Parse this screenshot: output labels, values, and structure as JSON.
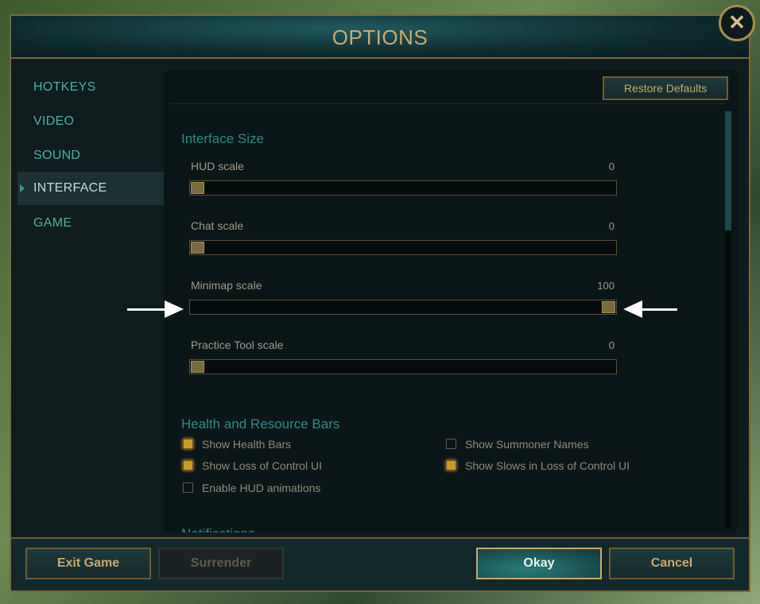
{
  "title": "OPTIONS",
  "close_icon": "close-x-icon",
  "sidebar": {
    "items": [
      {
        "label": "HOTKEYS"
      },
      {
        "label": "VIDEO"
      },
      {
        "label": "SOUND"
      },
      {
        "label": "INTERFACE",
        "active": true
      },
      {
        "label": "GAME"
      }
    ]
  },
  "restore_defaults": "Restore Defaults",
  "sections": {
    "interface_size": {
      "heading": "Interface Size",
      "sliders": [
        {
          "label": "HUD scale",
          "value": "0",
          "percent": 0
        },
        {
          "label": "Chat scale",
          "value": "0",
          "percent": 0
        },
        {
          "label": "Minimap scale",
          "value": "100",
          "percent": 100
        },
        {
          "label": "Practice Tool scale",
          "value": "0",
          "percent": 0
        }
      ]
    },
    "health_bars": {
      "heading": "Health and Resource Bars",
      "checkboxes": [
        {
          "label": "Show Health Bars",
          "checked": true
        },
        {
          "label": "Show Summoner Names",
          "checked": false
        },
        {
          "label": "Show Loss of Control UI",
          "checked": true
        },
        {
          "label": "Show Slows in Loss of Control UI",
          "checked": true
        },
        {
          "label": "Enable HUD animations",
          "checked": false
        }
      ]
    },
    "notifications": {
      "heading": "Notifications"
    }
  },
  "footer": {
    "exit": "Exit Game",
    "surrender": "Surrender",
    "okay": "Okay",
    "cancel": "Cancel"
  },
  "colors": {
    "gold": "#c8aa6e",
    "teal": "#2f8a85",
    "checked": "#c79a2a"
  }
}
